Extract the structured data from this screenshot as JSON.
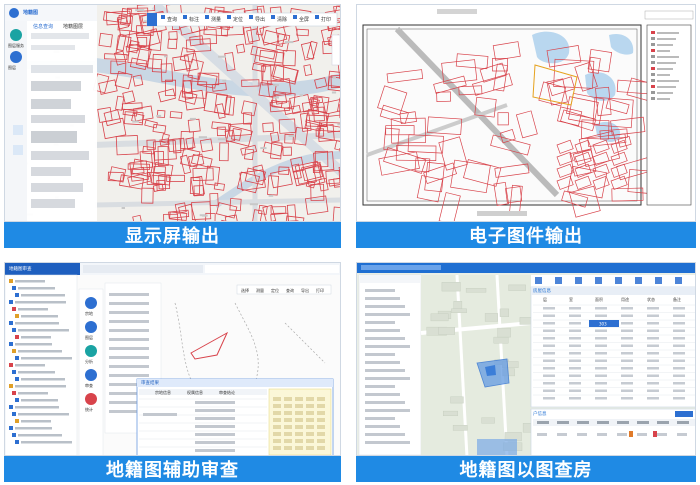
{
  "captions": {
    "p1": "显示屏输出",
    "p2": "电子图件输出",
    "p3": "地籍图辅助审查",
    "p4": "地籍图以图查房"
  },
  "p1": {
    "sidebar_title": "地籍图",
    "tabs": [
      "信息查询",
      "地籍图层"
    ],
    "side_items": [
      "图层服务",
      "图层",
      "数据导入"
    ],
    "toolbar": [
      "查询",
      "标注",
      "测量",
      "定位",
      "导出",
      "清除",
      "全屏",
      "打印"
    ]
  },
  "p3": {
    "header_tab": "地籍图审查",
    "toolbar": [
      "选择",
      "测量",
      "定位",
      "查询",
      "导出",
      "打印"
    ],
    "dialog_title": "审查结果",
    "dialog_tabs": [
      "宗地信息",
      "权属信息",
      "审查结论"
    ],
    "side_buttons": [
      "宗地",
      "图层",
      "分析",
      "审查",
      "统计"
    ]
  },
  "p4": {
    "dialog_title": "房屋信息",
    "table_header": [
      "层",
      "室",
      "面积",
      "用途",
      "状态",
      "备注"
    ],
    "selected_value": "303",
    "bottom_tab": "户信息"
  },
  "colors": {
    "caption_bg": "#1f8ae4",
    "brand_blue": "#2d6fd1",
    "parcel_red": "#d8434b",
    "map_gray": "#e9ecef"
  }
}
